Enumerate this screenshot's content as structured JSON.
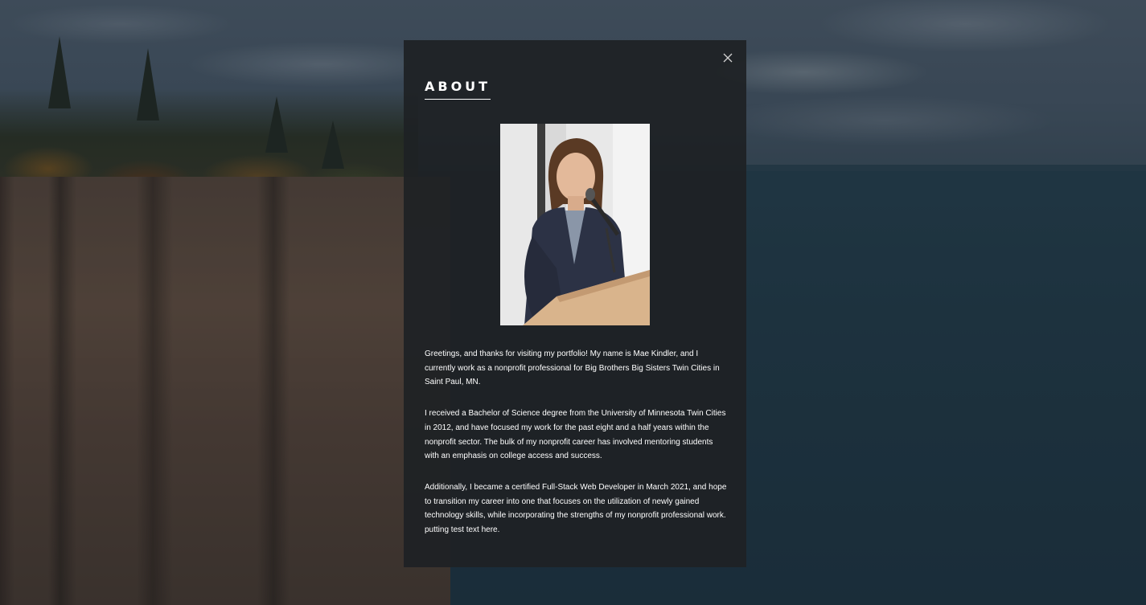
{
  "modal": {
    "title": "ABOUT",
    "close_icon": "close-icon",
    "photo_alt": "Portrait photo",
    "paragraphs": [
      "Greetings, and thanks for visiting my portfolio! My name is Mae Kindler, and I currently work as a nonprofit professional for Big Brothers Big Sisters Twin Cities in Saint Paul, MN.",
      "I received a Bachelor of Science degree from the University of Minnesota Twin Cities in 2012, and have focused my work for the past eight and a half years within the nonprofit sector. The bulk of my nonprofit career has involved mentoring students with an emphasis on college access and success.",
      "Additionally, I became a certified Full-Stack Web Developer in March 2021, and hope to transition my career into one that focuses on the utilization of newly gained technology skills, while incorporating the strengths of my nonprofit professional work. putting test text here."
    ]
  },
  "colors": {
    "modal_bg": "#1e2125",
    "text": "#ffffff",
    "blazer": "#2c3245"
  }
}
